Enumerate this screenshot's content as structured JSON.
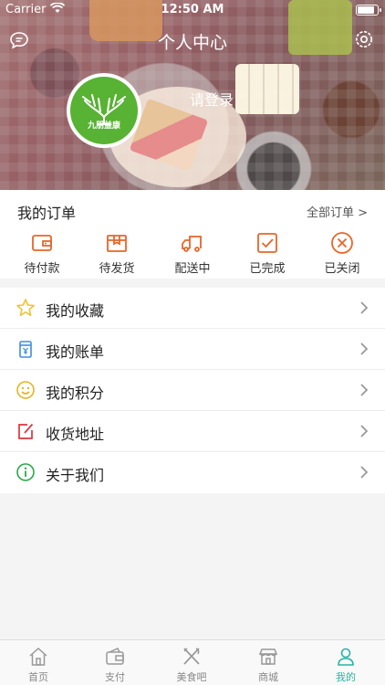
{
  "status": {
    "carrier": "Carrier",
    "time": "12:50 AM",
    "battery_level": 0.9
  },
  "nav": {
    "title": "个人中心",
    "left_icon": "message-icon",
    "right_icon": "gear-icon"
  },
  "profile": {
    "login_text": "请登录",
    "avatar_logo_text": "九朋益康"
  },
  "orders": {
    "title": "我的订单",
    "all_link": "全部订单 >",
    "accent": "#e8652a",
    "items": [
      {
        "label": "待付款",
        "icon": "wallet-icon"
      },
      {
        "label": "待发货",
        "icon": "box-icon"
      },
      {
        "label": "配送中",
        "icon": "truck-icon"
      },
      {
        "label": "已完成",
        "icon": "check-icon"
      },
      {
        "label": "已关闭",
        "icon": "close-icon"
      }
    ]
  },
  "menu": [
    {
      "label": "我的收藏",
      "icon": "star-icon",
      "color": "#f1c232"
    },
    {
      "label": "我的账单",
      "icon": "bill-icon",
      "color": "#3d8ee0"
    },
    {
      "label": "我的积分",
      "icon": "smile-icon",
      "color": "#e6b422"
    },
    {
      "label": "收货地址",
      "icon": "edit-icon",
      "color": "#d9363e"
    },
    {
      "label": "关于我们",
      "icon": "info-icon",
      "color": "#2aa84a"
    }
  ],
  "tabbar": {
    "active_color": "#2ab3a6",
    "items": [
      {
        "label": "首页",
        "icon": "home-icon",
        "active": false
      },
      {
        "label": "支付",
        "icon": "pay-icon",
        "active": false
      },
      {
        "label": "美食吧",
        "icon": "fork-knife-icon",
        "active": false
      },
      {
        "label": "商城",
        "icon": "store-icon",
        "active": false
      },
      {
        "label": "我的",
        "icon": "person-icon",
        "active": true
      }
    ]
  }
}
